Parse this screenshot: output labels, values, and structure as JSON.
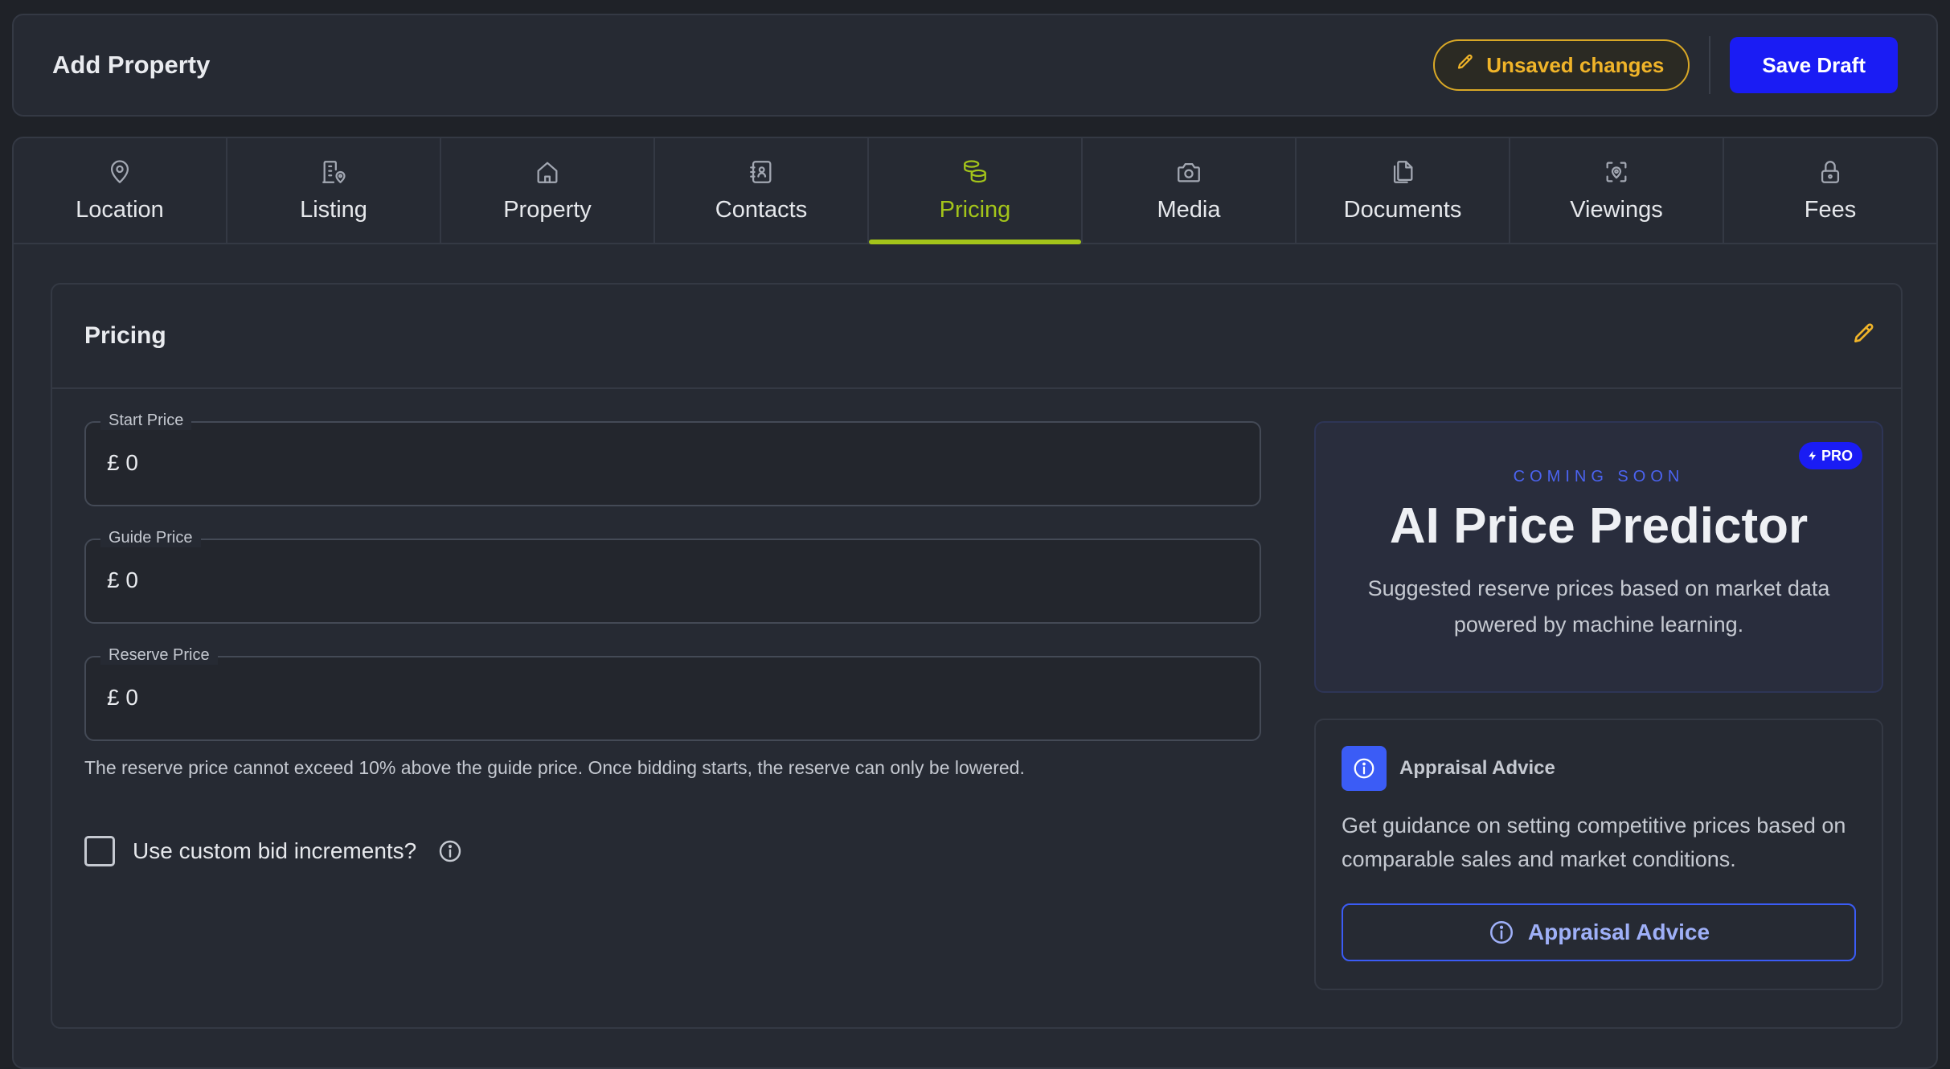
{
  "header": {
    "title": "Add Property",
    "unsaved_label": "Unsaved changes",
    "save_label": "Save Draft"
  },
  "tabs": [
    {
      "label": "Location",
      "icon": "map-pin-icon"
    },
    {
      "label": "Listing",
      "icon": "building-pin-icon"
    },
    {
      "label": "Property",
      "icon": "home-icon"
    },
    {
      "label": "Contacts",
      "icon": "address-book-icon"
    },
    {
      "label": "Pricing",
      "icon": "coins-icon",
      "active": true
    },
    {
      "label": "Media",
      "icon": "camera-icon"
    },
    {
      "label": "Documents",
      "icon": "files-icon"
    },
    {
      "label": "Viewings",
      "icon": "scan-location-icon"
    },
    {
      "label": "Fees",
      "icon": "lock-icon"
    }
  ],
  "pricing": {
    "title": "Pricing",
    "fields": [
      {
        "label": "Start Price",
        "value": "£ 0"
      },
      {
        "label": "Guide Price",
        "value": "£ 0"
      },
      {
        "label": "Reserve Price",
        "value": "£ 0"
      }
    ],
    "helper": "The reserve price cannot exceed 10% above the guide price. Once bidding starts, the reserve can only be lowered.",
    "custom_increments_label": "Use custom bid increments?"
  },
  "predictor": {
    "badge": "PRO",
    "coming": "COMING SOON",
    "title": "AI Price Predictor",
    "description": "Suggested reserve prices based on market data powered by machine learning."
  },
  "advice": {
    "title": "Appraisal Advice",
    "description": "Get guidance on setting competitive prices based on comparable sales and market conditions.",
    "button_label": "Appraisal Advice"
  },
  "colors": {
    "accent": "#a3c41a",
    "primary": "#1a1cf4",
    "warning": "#f0b429",
    "info": "#3b5cf6"
  }
}
